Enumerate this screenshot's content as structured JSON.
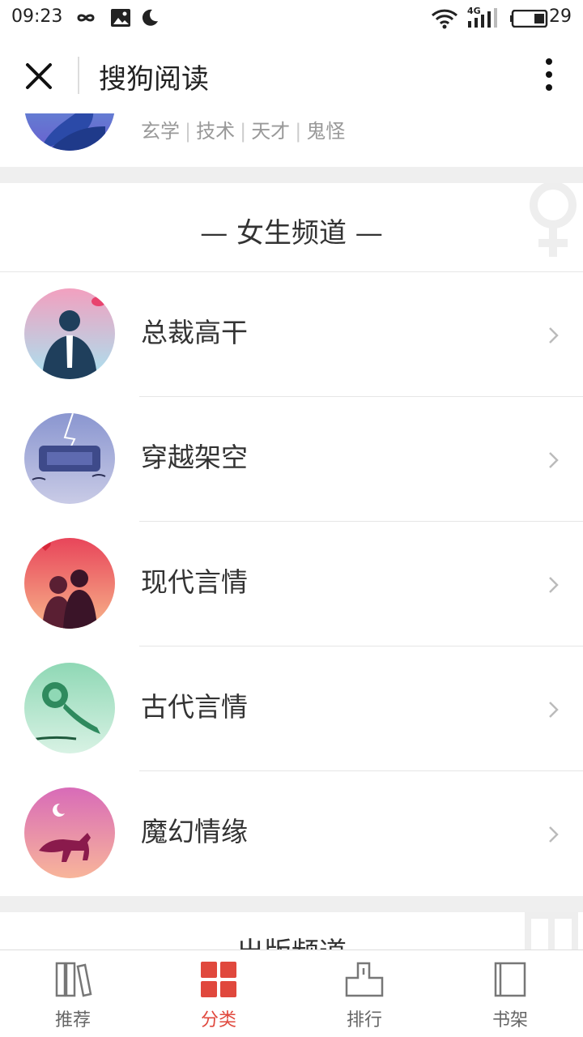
{
  "status_bar": {
    "time": "09:23",
    "network": "4G",
    "battery": "29"
  },
  "app_bar": {
    "title": "搜狗阅读"
  },
  "top_card": {
    "tags": [
      "玄学",
      "技术",
      "天才",
      "鬼怪"
    ]
  },
  "female_channel": {
    "title": "— 女生频道 —",
    "items": [
      {
        "label": "总裁高干",
        "icon": "suit-man-icon"
      },
      {
        "label": "穿越架空",
        "icon": "lock-lightning-icon"
      },
      {
        "label": "现代言情",
        "icon": "couple-icon"
      },
      {
        "label": "古代言情",
        "icon": "jade-ruyi-icon"
      },
      {
        "label": "魔幻情缘",
        "icon": "fox-icon"
      }
    ]
  },
  "publish_channel": {
    "title": "— 出版频道 —"
  },
  "tabs": [
    {
      "label": "推荐",
      "icon": "books-icon",
      "active": false
    },
    {
      "label": "分类",
      "icon": "grid-icon",
      "active": true
    },
    {
      "label": "排行",
      "icon": "podium-icon",
      "active": false
    },
    {
      "label": "书架",
      "icon": "book-icon",
      "active": false
    }
  ],
  "colors": {
    "accent": "#e0483d"
  }
}
